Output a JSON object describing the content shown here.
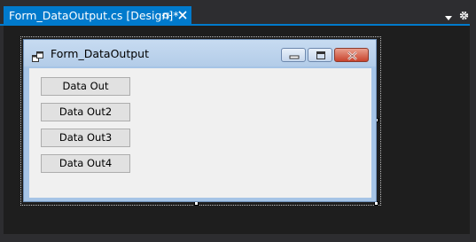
{
  "tab": {
    "title": "Form_DataOutput.cs [Design]*"
  },
  "form": {
    "title": "Form_DataOutput",
    "buttons": [
      "Data Out",
      "Data Out2",
      "Data Out3",
      "Data Out4"
    ]
  },
  "icons": {
    "tab_pin": "pin-icon",
    "tab_close": "close-icon",
    "strip_dropdown": "chevron-down-icon",
    "strip_settings": "gear-icon",
    "form_icon": "form-window-icon",
    "minimize": "minimize-icon",
    "maximize": "maximize-icon",
    "close": "close-icon"
  },
  "colors": {
    "accent": "#007acc",
    "ide_background": "#2d2d30",
    "designer_background": "#1e1e1e",
    "form_client": "#f0f0f0"
  }
}
